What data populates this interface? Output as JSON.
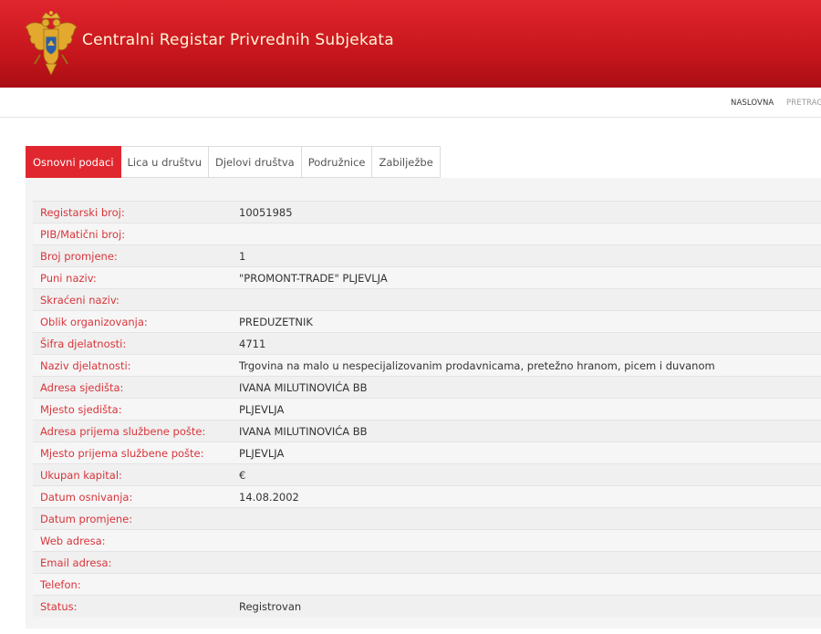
{
  "header": {
    "title": "Centralni Registar Privrednih Subjekata",
    "logo_icon": "montenegro-coat-of-arms-icon",
    "background_color": "#d11a22",
    "title_color": "#fff6d8"
  },
  "nav": {
    "home": "NASLOVNA",
    "search": "PRETRAG"
  },
  "tabs": [
    {
      "label": "Osnovni podaci",
      "active": true
    },
    {
      "label": "Lica u društvu",
      "active": false
    },
    {
      "label": "Djelovi društva",
      "active": false
    },
    {
      "label": "Podružnice",
      "active": false
    },
    {
      "label": "Zabilježbe",
      "active": false
    }
  ],
  "accent_color": "#e0272f",
  "details": [
    {
      "label": "Registarski broj:",
      "value": "10051985"
    },
    {
      "label": "PIB/Matični broj:",
      "value": ""
    },
    {
      "label": "Broj promjene:",
      "value": "1"
    },
    {
      "label": "Puni naziv:",
      "value": "\"PROMONT-TRADE\" PLJEVLJA"
    },
    {
      "label": "Skraćeni naziv:",
      "value": ""
    },
    {
      "label": "Oblik organizovanja:",
      "value": "PREDUZETNIK"
    },
    {
      "label": "Šifra djelatnosti:",
      "value": "4711"
    },
    {
      "label": "Naziv djelatnosti:",
      "value": "Trgovina na malo u nespecijalizovanim prodavnicama, pretežno hranom, picem i duvanom"
    },
    {
      "label": "Adresa sjedišta:",
      "value": "IVANA MILUTINOVIĆA BB"
    },
    {
      "label": "Mjesto sjedišta:",
      "value": "PLJEVLJA"
    },
    {
      "label": "Adresa prijema službene pošte:",
      "value": "IVANA MILUTINOVIĆA BB"
    },
    {
      "label": "Mjesto prijema službene pošte:",
      "value": "PLJEVLJA"
    },
    {
      "label": "Ukupan kapital:",
      "value": "€"
    },
    {
      "label": "Datum osnivanja:",
      "value": "14.08.2002"
    },
    {
      "label": "Datum promjene:",
      "value": ""
    },
    {
      "label": "Web adresa:",
      "value": ""
    },
    {
      "label": "Email adresa:",
      "value": ""
    },
    {
      "label": "Telefon:",
      "value": ""
    },
    {
      "label": "Status:",
      "value": "Registrovan"
    }
  ]
}
